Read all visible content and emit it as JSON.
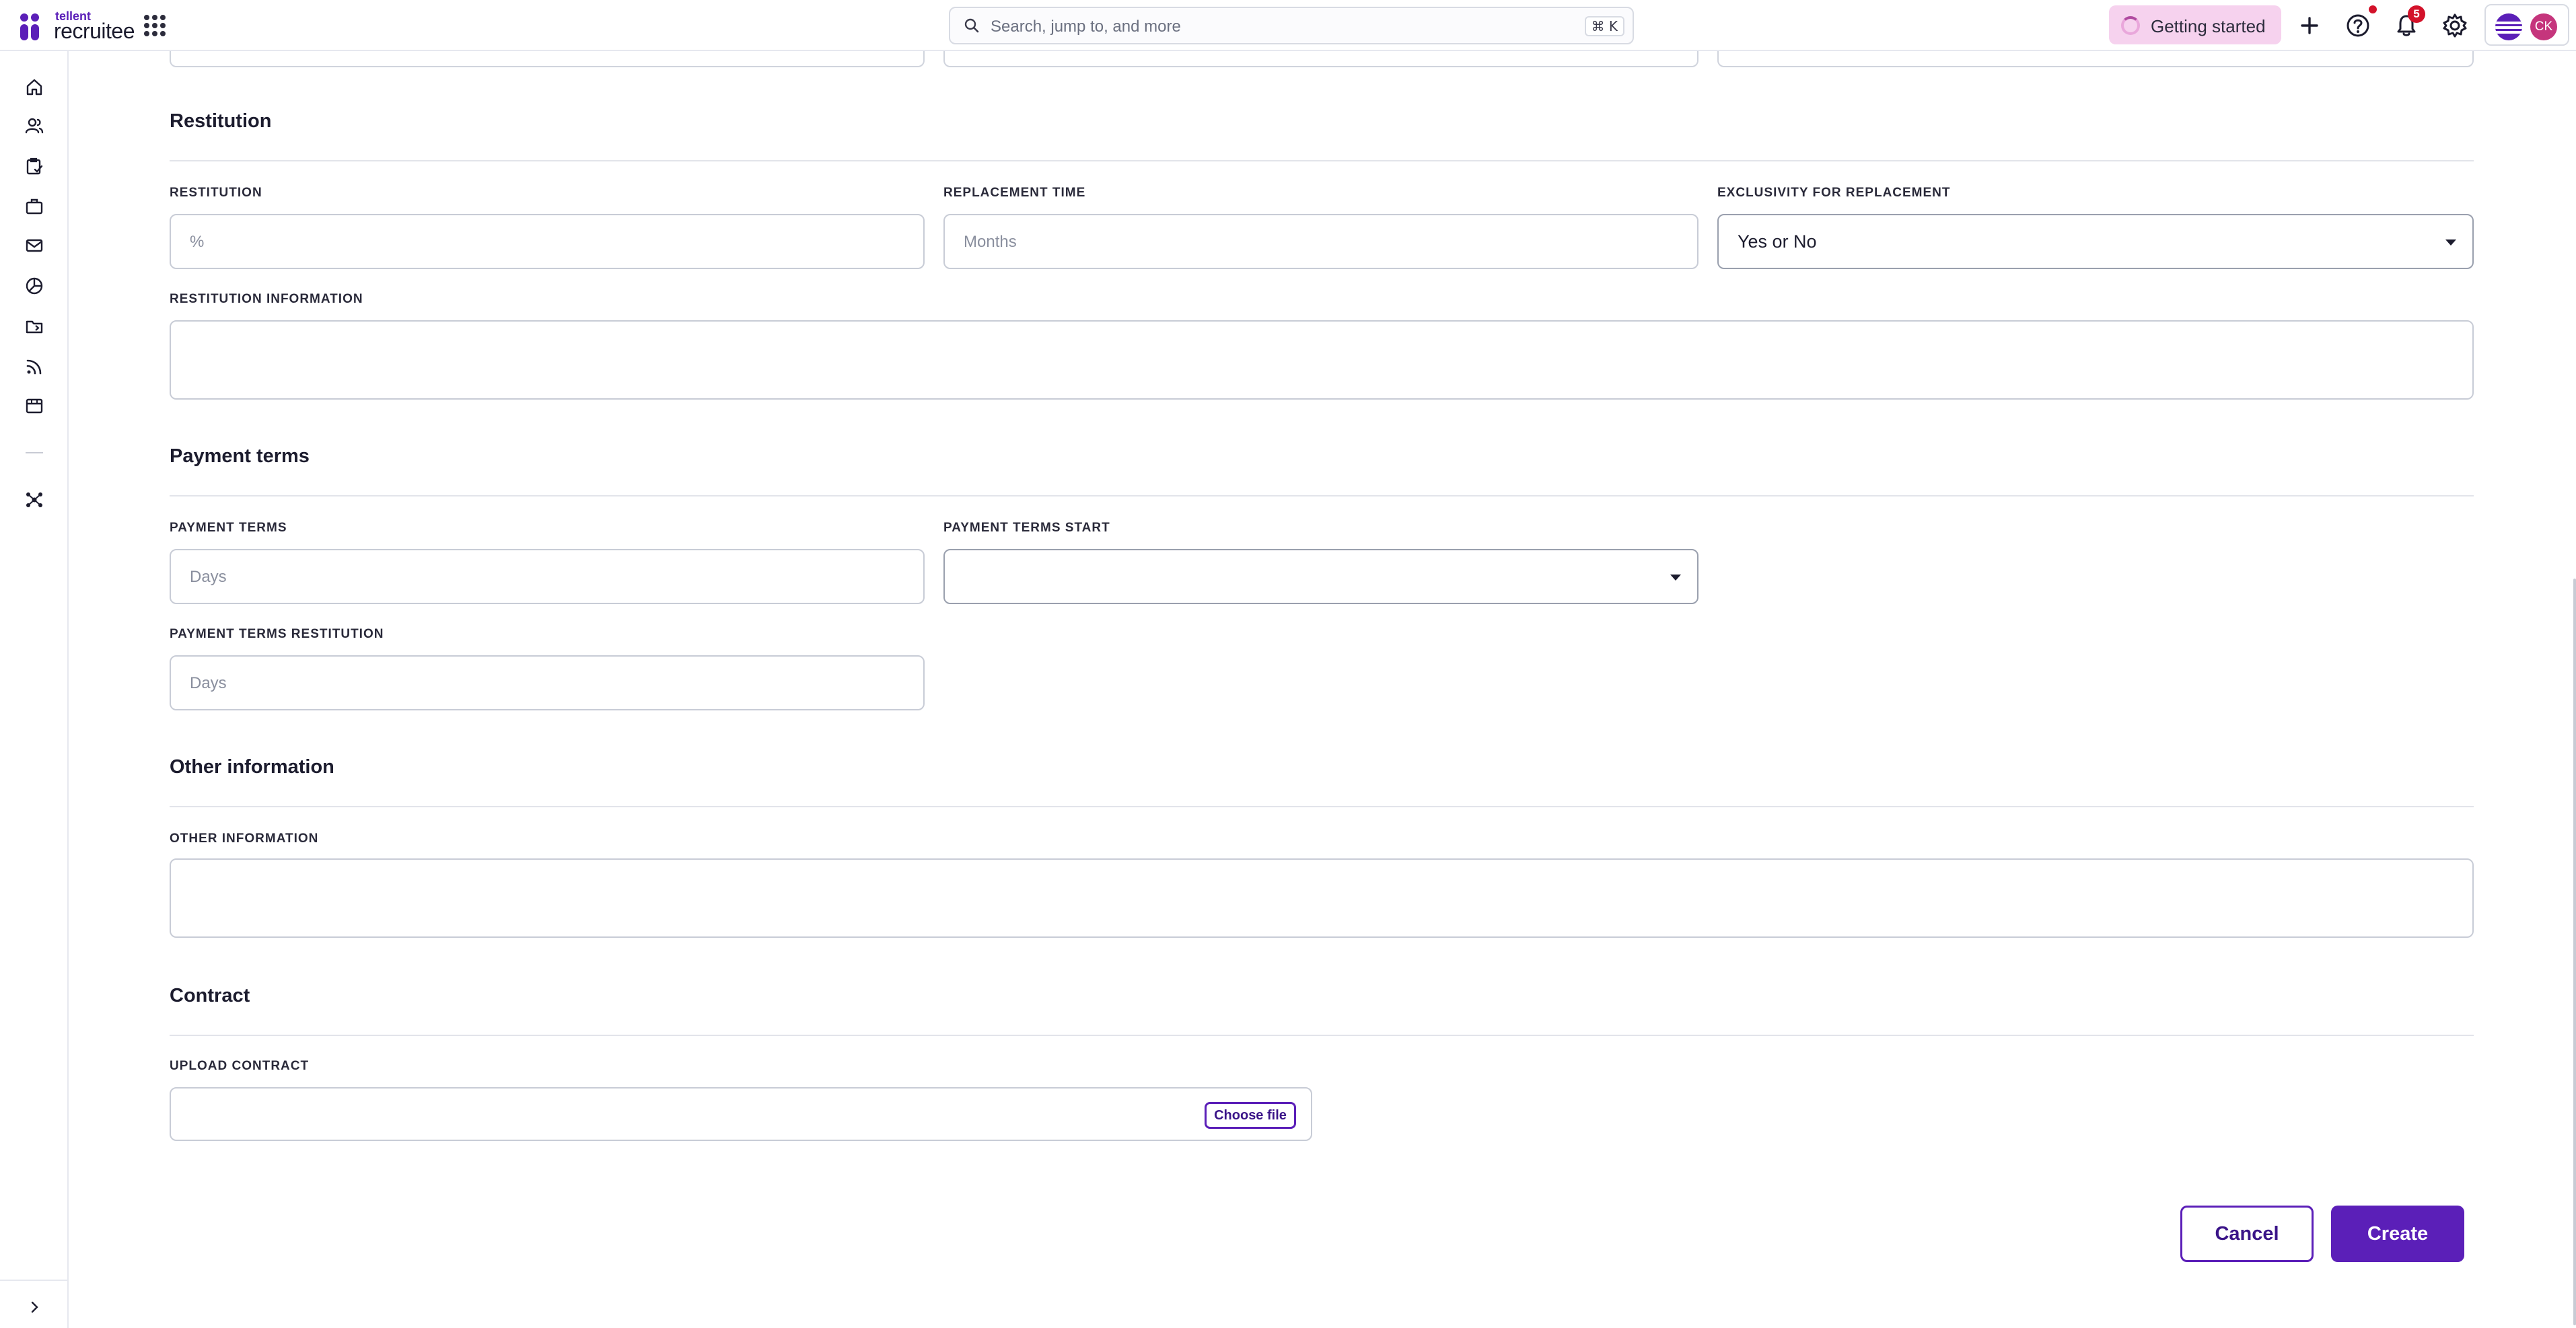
{
  "brand": {
    "top": "tellent",
    "name": "recruitee"
  },
  "search": {
    "placeholder": "Search, jump to, and more",
    "shortcut": "⌘ K"
  },
  "header": {
    "getting_started": "Getting started",
    "notifications_count": "5",
    "avatar_initials": "CK"
  },
  "icons": {
    "apps": "apps-grid-icon",
    "search": "search-icon",
    "plus": "plus-icon",
    "help": "help-icon",
    "bell": "bell-icon",
    "settings": "gear-icon",
    "sidebar": [
      "home-icon",
      "candidates-icon",
      "tasks-icon",
      "jobs-icon",
      "mailbox-icon",
      "reports-icon",
      "folder-icon",
      "feed-icon",
      "marketplace-icon",
      "integrations-icon"
    ],
    "expand": "chevron-right-icon"
  },
  "colors": {
    "accent": "#5b1fb8",
    "badge": "#d3122a",
    "getting_started_bg": "#f6d2ee",
    "avatar": "#c5357c"
  },
  "sections": {
    "restitution": {
      "title": "Restitution",
      "restitution_label": "RESTITUTION",
      "restitution_placeholder": "%",
      "replacement_time_label": "REPLACEMENT TIME",
      "replacement_time_placeholder": "Months",
      "exclusivity_label": "EXCLUSIVITY FOR REPLACEMENT",
      "exclusivity_value": "Yes or No",
      "information_label": "RESTITUTION INFORMATION",
      "information_value": ""
    },
    "payment_terms": {
      "title": "Payment terms",
      "terms_label": "PAYMENT TERMS",
      "terms_placeholder": "Days",
      "start_label": "PAYMENT TERMS START",
      "start_value": "",
      "restitution_label": "PAYMENT TERMS RESTITUTION",
      "restitution_placeholder": "Days"
    },
    "other_information": {
      "title": "Other information",
      "label": "OTHER INFORMATION",
      "value": ""
    },
    "contract": {
      "title": "Contract",
      "upload_label": "UPLOAD CONTRACT",
      "choose_file": "Choose file"
    }
  },
  "actions": {
    "cancel": "Cancel",
    "create": "Create"
  }
}
